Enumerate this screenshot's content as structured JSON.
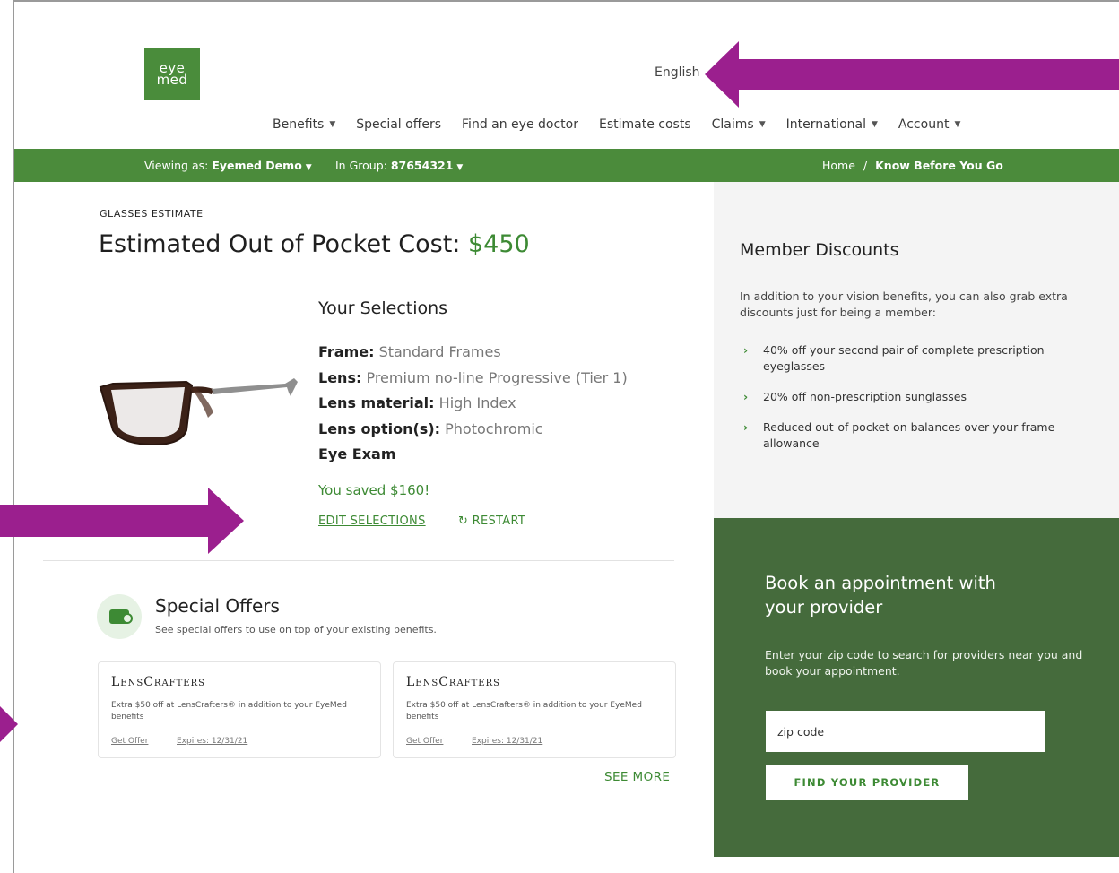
{
  "header": {
    "logo_line1": "eye",
    "logo_line2": "med",
    "language": "English"
  },
  "nav": {
    "items": [
      {
        "label": "Benefits",
        "dropdown": true
      },
      {
        "label": "Special offers",
        "dropdown": false
      },
      {
        "label": "Find an eye doctor",
        "dropdown": false
      },
      {
        "label": "Estimate costs",
        "dropdown": false
      },
      {
        "label": "Claims",
        "dropdown": true
      },
      {
        "label": "International",
        "dropdown": true
      },
      {
        "label": "Account",
        "dropdown": true
      }
    ]
  },
  "greenbar": {
    "viewing_label": "Viewing as:",
    "viewing_value": "Eyemed Demo",
    "group_label": "In Group:",
    "group_value": "87654321",
    "breadcrumb_home": "Home",
    "breadcrumb_sep": "/",
    "breadcrumb_current": "Know Before You Go"
  },
  "estimate": {
    "eyebrow": "GLASSES ESTIMATE",
    "title": "Estimated Out of Pocket Cost:",
    "price": "$450"
  },
  "selections": {
    "heading": "Your Selections",
    "items": [
      {
        "label": "Frame:",
        "value": "Standard Frames"
      },
      {
        "label": "Lens:",
        "value": "Premium no-line Progressive (Tier 1)"
      },
      {
        "label": "Lens material:",
        "value": "High Index"
      },
      {
        "label": "Lens option(s):",
        "value": "Photochromic"
      },
      {
        "label": "Eye Exam",
        "value": ""
      }
    ],
    "saved": "You saved $160!",
    "edit_label": "EDIT SELECTIONS",
    "restart_label": "↻ RESTART"
  },
  "special_offers": {
    "heading": "Special Offers",
    "subheading": "See special offers to use on top of your existing benefits.",
    "cards": [
      {
        "brand": "LensCrafters",
        "desc": "Extra $50 off at LensCrafters® in addition to your EyeMed benefits",
        "get_offer": "Get Offer",
        "expires": "Expires: 12/31/21"
      },
      {
        "brand": "LensCrafters",
        "desc": "Extra $50 off at LensCrafters® in addition to your EyeMed benefits",
        "get_offer": "Get Offer",
        "expires": "Expires: 12/31/21"
      }
    ],
    "see_more": "SEE MORE"
  },
  "discounts": {
    "heading": "Member Discounts",
    "intro": "In addition to your vision benefits, you can also grab extra discounts just for being a member:",
    "items": [
      "40% off your second pair of complete prescription eyeglasses",
      "20% off non-prescription sunglasses",
      "Reduced out-of-pocket on balances over your frame allowance"
    ]
  },
  "book": {
    "heading": "Book an appointment with your provider",
    "sub": "Enter your zip code to search for providers near you and book your appointment.",
    "zip_placeholder": "zip code",
    "button": "FIND YOUR PROVIDER"
  },
  "colors": {
    "brand_green": "#4b8b3b",
    "accent_green": "#3d8a34",
    "book_panel": "#456b3c",
    "annotation_arrow": "#9b1f8e"
  }
}
